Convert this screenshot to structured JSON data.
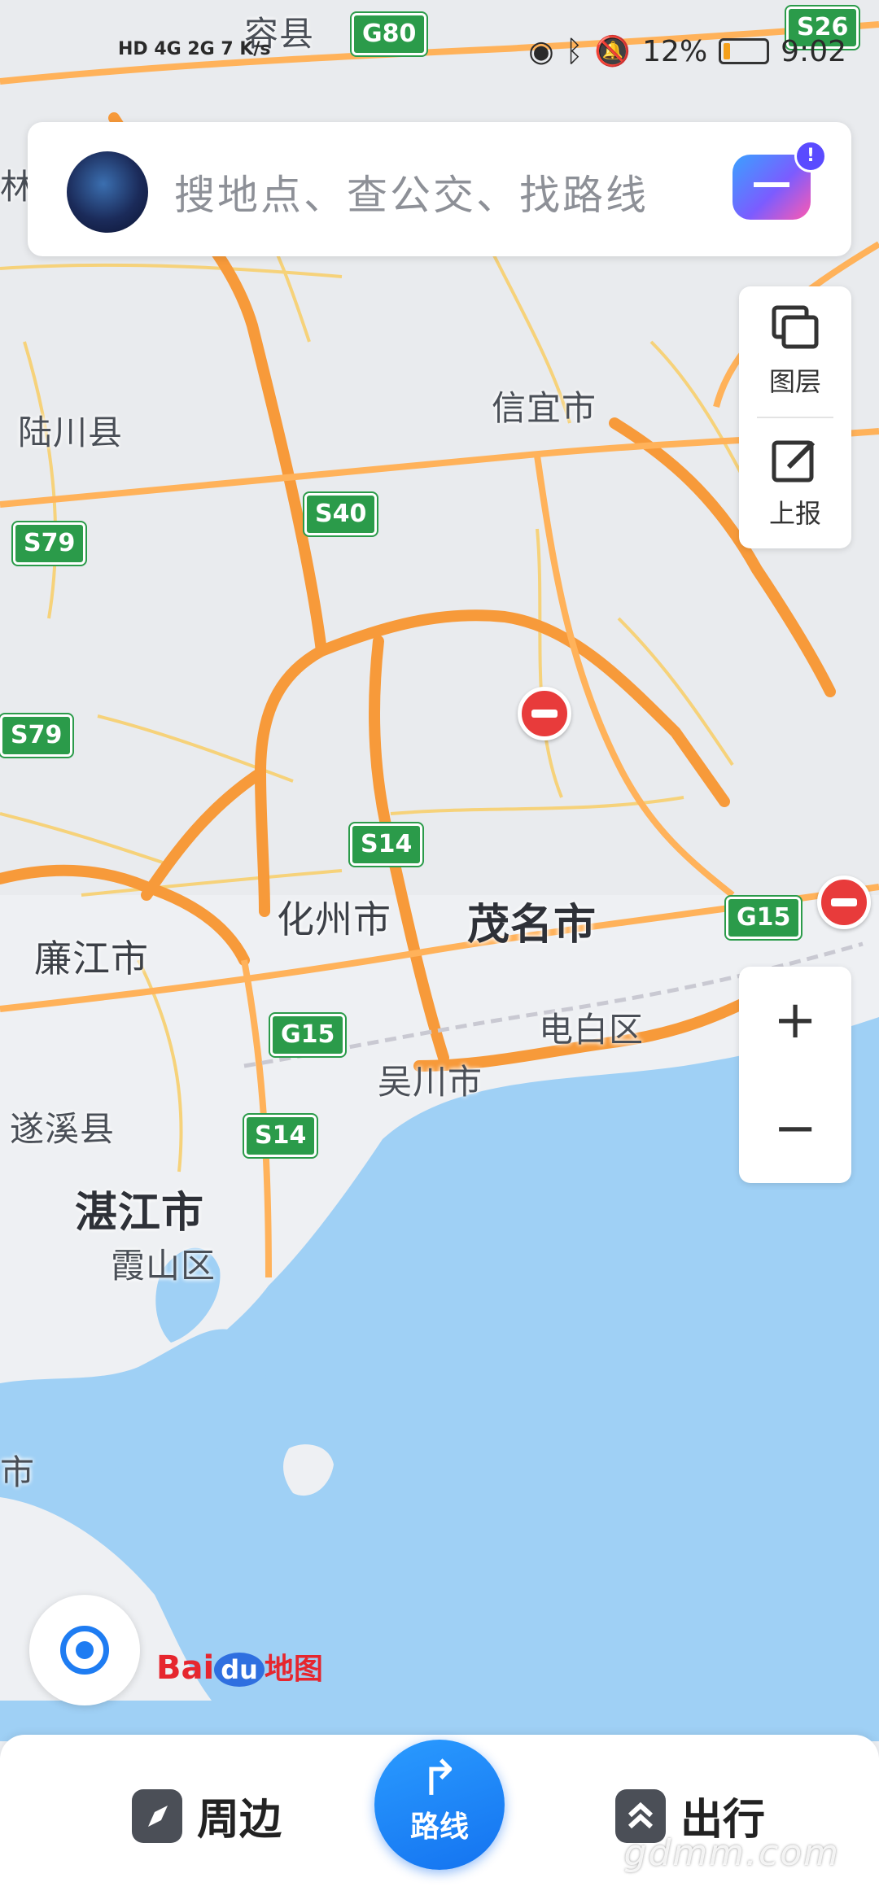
{
  "status_bar": {
    "left": "HD 4G 2G 7 K/s",
    "battery": "12%",
    "time": "9:02"
  },
  "search": {
    "placeholder": "搜地点、查公交、找路线",
    "assistant_badge": "!"
  },
  "side_panel": {
    "layers_label": "图层",
    "report_label": "上报"
  },
  "zoom": {
    "in": "+",
    "out": "−"
  },
  "map": {
    "places": [
      "容县",
      "信宜市",
      "陆川县",
      "化州市",
      "茂名市",
      "廉江市",
      "电白区",
      "吴川市",
      "遂溪县",
      "湛江市",
      "霞山区",
      "林",
      "市"
    ],
    "road_shields": [
      "G80",
      "S26",
      "S40",
      "S79",
      "S79",
      "S14",
      "G15",
      "G15",
      "S14"
    ]
  },
  "logo": {
    "bai": "Bai",
    "du": "du",
    "map": "地图"
  },
  "bottom_nav": {
    "nearby": "周边",
    "route": "路线",
    "travel": "出行"
  },
  "watermark": "gdmm.com",
  "colors": {
    "accent": "#1e7cf2",
    "highway": "#f79a3a",
    "sea": "#9fd0f5",
    "shield": "#2b9b4a"
  }
}
